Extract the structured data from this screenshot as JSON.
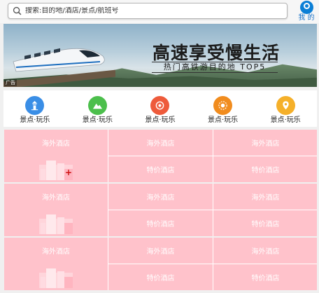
{
  "search": {
    "placeholder": "搜索:目的地/酒店/景点/航班号",
    "value": ""
  },
  "header": {
    "me_label": "我 的"
  },
  "banner": {
    "headline": "高速享受慢生活",
    "subline": "热门高铁游目的地 TOP5",
    "ad_label": "广告"
  },
  "categories": [
    {
      "label": "景点·玩乐",
      "icon": "tower-icon",
      "color": "#3a8ee6"
    },
    {
      "label": "景点·玩乐",
      "icon": "mountain-icon",
      "color": "#4cbf4c"
    },
    {
      "label": "景点·玩乐",
      "icon": "camera-icon",
      "color": "#ee5b3b"
    },
    {
      "label": "景点·玩乐",
      "icon": "sun-icon",
      "color": "#f18c1e"
    },
    {
      "label": "景点·玩乐",
      "icon": "location-icon",
      "color": "#f5b02a"
    }
  ],
  "blocks": [
    {
      "main": "海外酒店",
      "cells": [
        "海外酒店",
        "海外酒店",
        "特价酒店",
        "特价酒店"
      ]
    },
    {
      "main": "海外酒店",
      "cells": [
        "海外酒店",
        "海外酒店",
        "特价酒店",
        "特价酒店"
      ]
    },
    {
      "main": "海外酒店",
      "cells": [
        "海外酒店",
        "海外酒店",
        "特价酒店",
        "特价酒店"
      ]
    }
  ],
  "colors": {
    "accent": "#0c7fd6",
    "tile": "#ffc2cb"
  }
}
